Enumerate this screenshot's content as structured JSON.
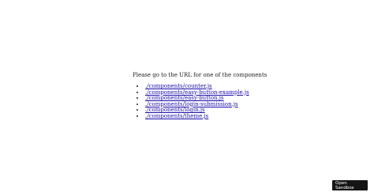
{
  "intro": "Please go to the URL for one of the components",
  "links": [
    {
      "label": "./components/counter.js"
    },
    {
      "label": "./components/easy-button-example.js"
    },
    {
      "label": "./components/easy-button.js"
    },
    {
      "label": "./components/login-submission.js"
    },
    {
      "label": "./components/login.js"
    },
    {
      "label": "./components/theme.js"
    }
  ],
  "sandbox_button": {
    "label": "Open Sandbox"
  }
}
